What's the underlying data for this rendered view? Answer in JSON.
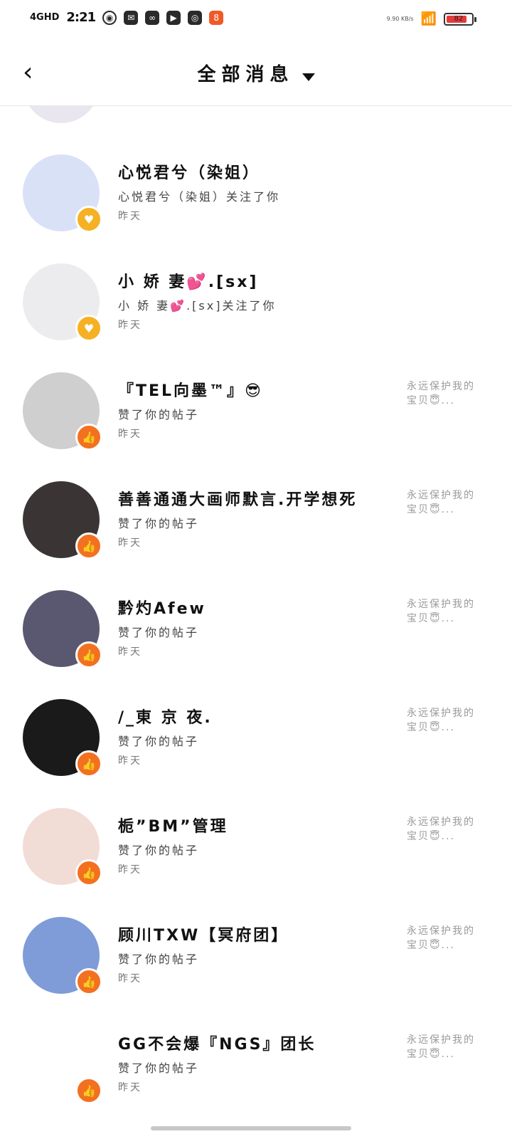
{
  "status_bar": {
    "network": "4GHD",
    "time": "2:21",
    "speed": "9.90 KB/s",
    "battery": "82",
    "battery_level": 0.82
  },
  "header": {
    "back_icon": "chevron-left-icon",
    "title": "全部消息",
    "dropdown_icon": "caret-down-icon"
  },
  "colors": {
    "like_badge": "#f37021",
    "follow_badge": "#f5b123"
  },
  "notifications": [
    {
      "name": "心悦君兮（染姐）",
      "action": "心悦君兮（染姐）关注了你",
      "time": "昨天",
      "badge": "heart-icon",
      "snippet": "",
      "avatar_color": "#d9e1f7"
    },
    {
      "name": "小 娇 妻💕.[sx]",
      "action": "小 娇 妻💕.[sx]关注了你",
      "time": "昨天",
      "badge": "heart-icon",
      "snippet": "",
      "avatar_color": "#ececee"
    },
    {
      "name": "『TEL向墨™』😎",
      "action": "赞了你的帖子",
      "time": "昨天",
      "badge": "thumbs-up-icon",
      "snippet": "永远保护我的宝贝😇...",
      "avatar_color": "#cfcfcf"
    },
    {
      "name": "善善通通大画师默言.开学想死",
      "action": "赞了你的帖子",
      "time": "昨天",
      "badge": "thumbs-up-icon",
      "snippet": "永远保护我的宝贝😇...",
      "avatar_color": "#3a3534"
    },
    {
      "name": "黔灼Afew",
      "action": "赞了你的帖子",
      "time": "昨天",
      "badge": "thumbs-up-icon",
      "snippet": "永远保护我的宝贝😇...",
      "avatar_color": "#5a5870"
    },
    {
      "name": "/_東 京 夜.",
      "action": "赞了你的帖子",
      "time": "昨天",
      "badge": "thumbs-up-icon",
      "snippet": "永远保护我的宝贝😇...",
      "avatar_color": "#1a1a1a"
    },
    {
      "name": "栀”BM”管理",
      "action": "赞了你的帖子",
      "time": "昨天",
      "badge": "thumbs-up-icon",
      "snippet": "永远保护我的宝贝😇...",
      "avatar_color": "#f2dcd6"
    },
    {
      "name": "顾川TXW【冥府团】",
      "action": "赞了你的帖子",
      "time": "昨天",
      "badge": "thumbs-up-icon",
      "snippet": "永远保护我的宝贝😇...",
      "avatar_color": "#7f9bd8"
    },
    {
      "name": "GG不会爆『NGS』团长",
      "action": "赞了你的帖子",
      "time": "昨天",
      "badge": "thumbs-up-icon",
      "snippet": "永远保护我的宝贝😇...",
      "avatar_color": "#ffffff"
    }
  ]
}
